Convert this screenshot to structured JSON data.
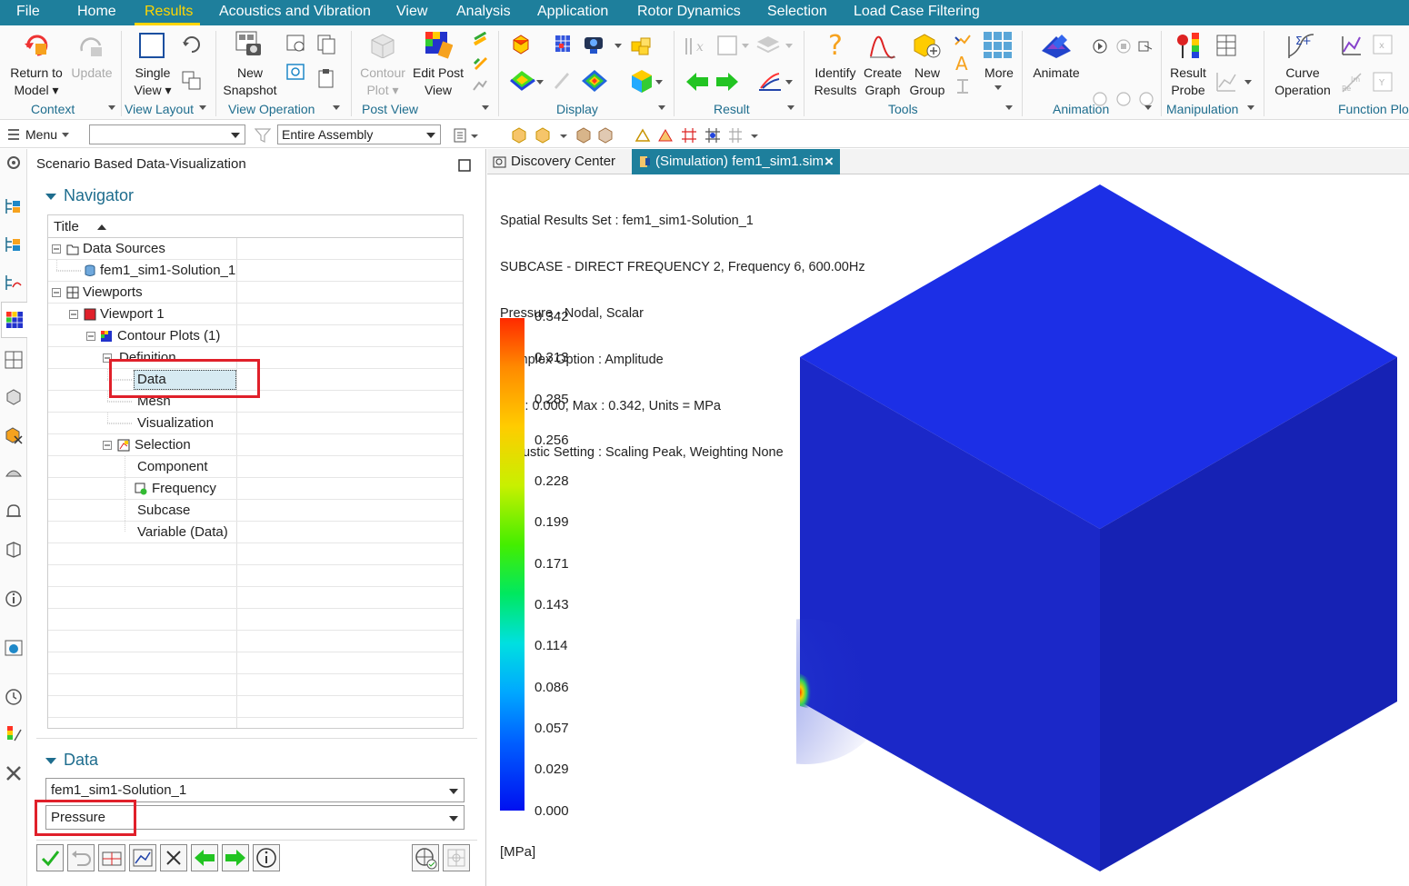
{
  "menubar": {
    "items": [
      "File",
      "Home",
      "Results",
      "Acoustics and Vibration",
      "View",
      "Analysis",
      "Application",
      "Rotor Dynamics",
      "Selection",
      "Load Case Filtering"
    ],
    "active": "Results"
  },
  "ribbon": {
    "buttons": {
      "return_to_model": "Return to\nModel ▾",
      "update": "Update",
      "single_view": "Single\nView ▾",
      "new_snapshot": "New\nSnapshot",
      "contour_plot": "Contour\nPlot ▾",
      "edit_post_view": "Edit Post\nView",
      "identify_results": "Identify\nResults",
      "create_graph": "Create\nGraph",
      "new_group": "New\nGroup",
      "more": "More",
      "animate": "Animate",
      "result_probe": "Result\nProbe",
      "curve_operation": "Curve\nOperation"
    },
    "groups": [
      "Context",
      "View Layout",
      "View Operation",
      "Post View",
      "Display",
      "Result",
      "Tools",
      "Animation",
      "Manipulation",
      "Function Plot"
    ]
  },
  "toolbar2": {
    "menu_label": "Menu",
    "filter_value": "",
    "scope_value": "Entire Assembly"
  },
  "panel": {
    "title": "Scenario Based Data-Visualization",
    "navigator_header": "Navigator",
    "tree_column_title": "Title",
    "tree": [
      {
        "label": "Data Sources"
      },
      {
        "label": "fem1_sim1-Solution_1"
      },
      {
        "label": "Viewports"
      },
      {
        "label": "Viewport 1"
      },
      {
        "label": "Contour Plots (1)"
      },
      {
        "label": "Definition"
      },
      {
        "label": "Data"
      },
      {
        "label": "Mesh"
      },
      {
        "label": "Visualization"
      },
      {
        "label": "Selection"
      },
      {
        "label": "Component"
      },
      {
        "label": "Frequency"
      },
      {
        "label": "Subcase"
      },
      {
        "label": "Variable (Data)"
      }
    ],
    "data_header": "Data",
    "data_source_value": "fem1_sim1-Solution_1",
    "data_variable_value": "Pressure"
  },
  "tabs": {
    "discovery": "Discovery Center",
    "simulation": "(Simulation) fem1_sim1.sim",
    "close": "×"
  },
  "viewport": {
    "info_lines": [
      "Spatial Results Set : fem1_sim1-Solution_1",
      "SUBCASE - DIRECT FREQUENCY 2, Frequency 6, 600.00Hz",
      "Pressure - Nodal, Scalar",
      "Complex Option : Amplitude",
      "Min : 0.000, Max : 0.342, Units = MPa",
      "Acoustic Setting : Scaling Peak, Weighting None"
    ],
    "legend_values": [
      "0.342",
      "0.313",
      "0.285",
      "0.256",
      "0.228",
      "0.199",
      "0.171",
      "0.143",
      "0.114",
      "0.086",
      "0.057",
      "0.029",
      "0.000"
    ],
    "units": "[MPa]",
    "colors": {
      "cube_top": "#1c2fe6",
      "cube_left": "#1b28c8",
      "cube_right": "#1622b4"
    }
  }
}
